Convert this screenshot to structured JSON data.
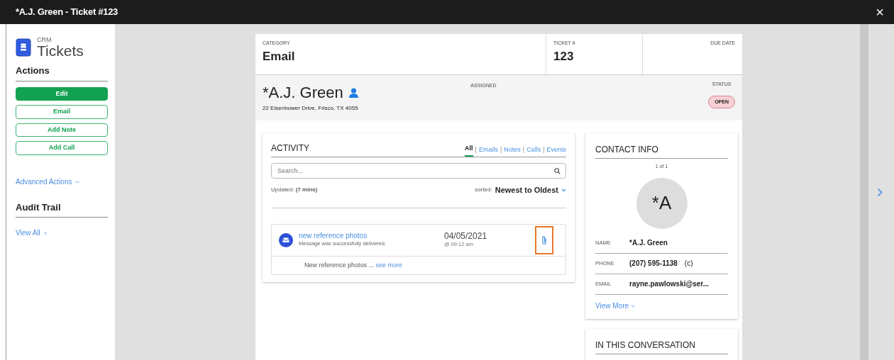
{
  "window": {
    "title": "*A.J. Green - Ticket #123",
    "close": "×"
  },
  "sidebar": {
    "app_label": "CRM",
    "app_title": "Tickets",
    "actions_heading": "Actions",
    "actions": [
      {
        "label": "Edit",
        "kind": "primary"
      },
      {
        "label": "Email",
        "kind": "outline"
      },
      {
        "label": "Add Note",
        "kind": "outline"
      },
      {
        "label": "Add Call",
        "kind": "outline"
      }
    ],
    "advanced_actions": "Advanced Actions",
    "audit_heading": "Audit Trail",
    "view_all": "View All"
  },
  "ticket": {
    "category_label": "CATEGORY",
    "category": "Email",
    "number_label": "TICKET #",
    "number": "123",
    "due_label": "DUE DATE"
  },
  "contact_header": {
    "name": "*A.J. Green",
    "address": "22 Eisenhower Drive, Frisco, TX 4055",
    "assigned_label": "ASSIGNED",
    "status_label": "STATUS",
    "status": "OPEN"
  },
  "activity": {
    "title": "ACTIVITY",
    "filters": [
      {
        "label": "All",
        "selected": true
      },
      {
        "label": "Emails",
        "selected": false
      },
      {
        "label": "Notes",
        "selected": false
      },
      {
        "label": "Calls",
        "selected": false
      },
      {
        "label": "Events",
        "selected": false
      }
    ],
    "separator": "|",
    "search": {
      "placeholder": "Search..."
    },
    "updated": "Updated: **(7 mins)**",
    "sorted_label": "sorted:",
    "sort": "Newest to Oldest",
    "items": [
      {
        "title": "new reference photos",
        "subtitle": "Message was successfully delivered.",
        "date": "04/05/2021",
        "time": "@ 09:12 am",
        "body": "New reference photos ...",
        "see_more": "see more",
        "attachment_highlighted": true
      }
    ]
  },
  "contact_info": {
    "title": "CONTACT INFO",
    "pager": "1 of 1",
    "avatar": "*A",
    "rows": [
      {
        "label": "NAME",
        "value": "*A.J. Green"
      },
      {
        "label": "PHONE",
        "value": "(207) 595-1138",
        "suffix": "(c)"
      },
      {
        "label": "EMAIL",
        "value": "rayne.pawlowski@ser..."
      }
    ],
    "view_more": "View More"
  },
  "conversation": {
    "title": "IN THIS CONVERSATION"
  }
}
